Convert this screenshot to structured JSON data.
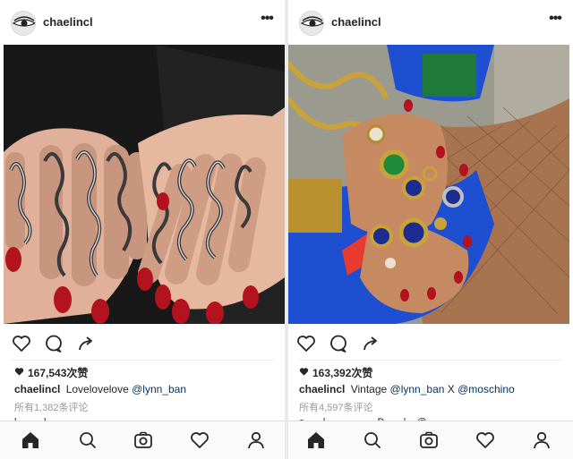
{
  "posts": [
    {
      "username": "chaelincl",
      "likes": "167,543次赞",
      "caption": {
        "username": "chaelincl",
        "text": "Lovelovelove",
        "mentions": [
          "@lynn_ban"
        ]
      },
      "comments": "所有1,382条评论",
      "next_line": "l _ _ _ l _ _ _ _ _ _ _ _"
    },
    {
      "username": "chaelincl",
      "likes": "163,392次赞",
      "caption": {
        "username": "chaelincl",
        "text": "Vintage",
        "mentions": [
          "@lynn_ban",
          "X",
          "@moschino"
        ]
      },
      "comments": "所有4,597条评论",
      "next_line": "c _ _ l _ _ _ _ _ _ D _ _ l _ @ _ _ _ _ _ _"
    }
  ],
  "icons": {
    "more": "more-horizontal-icon",
    "like": "heart-outline-icon",
    "comment": "comment-bubble-icon",
    "share": "share-arrow-icon",
    "likes_heart": "heart-filled-icon",
    "tabs": [
      "home-icon",
      "search-icon",
      "camera-icon",
      "heart-outline-icon",
      "profile-icon"
    ]
  },
  "more_label": "•••",
  "colors": {
    "mention": "#003569",
    "muted": "#999999",
    "text": "#262626"
  }
}
